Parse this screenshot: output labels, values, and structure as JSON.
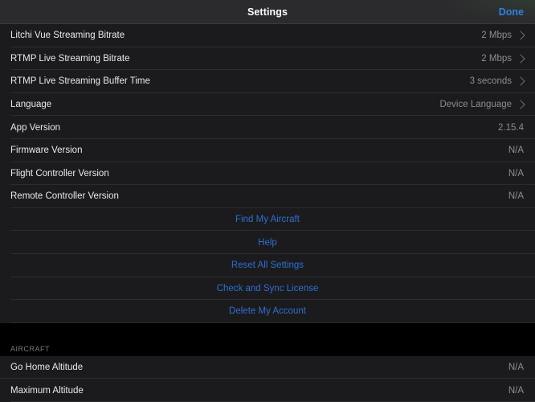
{
  "navbar": {
    "title": "Settings",
    "done_label": "Done"
  },
  "main": {
    "settings_rows": [
      {
        "label": "Litchi Vue Streaming Bitrate",
        "value": "2 Mbps",
        "chevron": true
      },
      {
        "label": "RTMP Live Streaming Bitrate",
        "value": "2 Mbps",
        "chevron": true
      },
      {
        "label": "RTMP Live Streaming Buffer Time",
        "value": "3 seconds",
        "chevron": true
      },
      {
        "label": "Language",
        "value": "Device Language",
        "chevron": true
      },
      {
        "label": "App Version",
        "value": "2.15.4",
        "chevron": false
      },
      {
        "label": "Firmware Version",
        "value": "N/A",
        "chevron": false
      },
      {
        "label": "Flight Controller Version",
        "value": "N/A",
        "chevron": false
      },
      {
        "label": "Remote Controller Version",
        "value": "N/A",
        "chevron": false
      }
    ],
    "action_rows": [
      {
        "label": "Find My Aircraft"
      },
      {
        "label": "Help"
      },
      {
        "label": "Reset All Settings"
      },
      {
        "label": "Check and Sync License"
      },
      {
        "label": "Delete My Account"
      }
    ],
    "aircraft_section": {
      "header": "AIRCRAFT",
      "rows": [
        {
          "label": "Go Home Altitude",
          "value": "N/A",
          "chevron": false
        },
        {
          "label": "Maximum Altitude",
          "value": "N/A",
          "chevron": false
        }
      ]
    }
  },
  "colors": {
    "accent_blue": "#2f7fe0",
    "link_blue": "#2f6fd0",
    "row_background": "#1b1b1d",
    "navbar_background": "#2b2b2d",
    "page_background": "#000000",
    "value_gray": "#8d8d92",
    "label_white": "#e9e9ea"
  }
}
